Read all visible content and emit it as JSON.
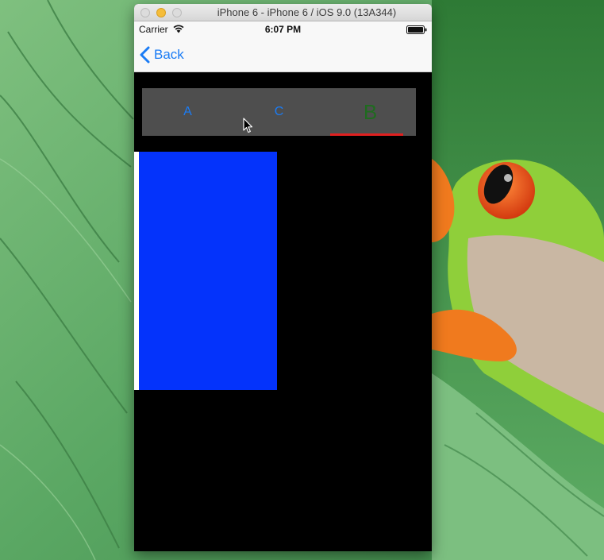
{
  "window": {
    "title": "iPhone 6 - iPhone 6 / iOS 9.0 (13A344)"
  },
  "statusbar": {
    "carrier": "Carrier",
    "time": "6:07 PM"
  },
  "navbar": {
    "back_label": "Back"
  },
  "tabs": [
    {
      "label": "A",
      "selected": false
    },
    {
      "label": "C",
      "selected": false
    },
    {
      "label": "B",
      "selected": true
    }
  ],
  "colors": {
    "tab_bar_bg": "#4e4e4e",
    "tab_label": "#1a7cf5",
    "selected_tab_label": "#1f6b1f",
    "indicator": "#e02020",
    "panel": "#0433fb",
    "ios_tint": "#1a7cf5"
  },
  "icons": [
    "back-chevron-icon",
    "wifi-icon",
    "battery-icon",
    "mouse-cursor-icon"
  ]
}
